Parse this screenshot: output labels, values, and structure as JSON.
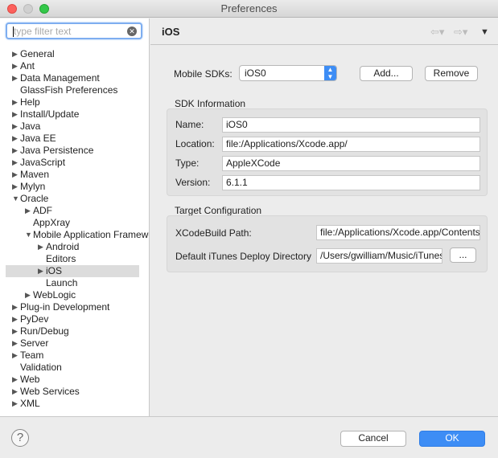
{
  "window": {
    "title": "Preferences"
  },
  "filter": {
    "placeholder": "type filter text"
  },
  "tree": [
    {
      "label": "General",
      "level": 0,
      "arrow": "right"
    },
    {
      "label": "Ant",
      "level": 0,
      "arrow": "right"
    },
    {
      "label": "Data Management",
      "level": 0,
      "arrow": "right"
    },
    {
      "label": "GlassFish Preferences",
      "level": 0,
      "arrow": ""
    },
    {
      "label": "Help",
      "level": 0,
      "arrow": "right"
    },
    {
      "label": "Install/Update",
      "level": 0,
      "arrow": "right"
    },
    {
      "label": "Java",
      "level": 0,
      "arrow": "right"
    },
    {
      "label": "Java EE",
      "level": 0,
      "arrow": "right"
    },
    {
      "label": "Java Persistence",
      "level": 0,
      "arrow": "right"
    },
    {
      "label": "JavaScript",
      "level": 0,
      "arrow": "right"
    },
    {
      "label": "Maven",
      "level": 0,
      "arrow": "right"
    },
    {
      "label": "Mylyn",
      "level": 0,
      "arrow": "right"
    },
    {
      "label": "Oracle",
      "level": 0,
      "arrow": "down"
    },
    {
      "label": "ADF",
      "level": 1,
      "arrow": "right"
    },
    {
      "label": "AppXray",
      "level": 1,
      "arrow": ""
    },
    {
      "label": "Mobile Application Framework",
      "level": 1,
      "arrow": "down"
    },
    {
      "label": "Android",
      "level": 2,
      "arrow": "right"
    },
    {
      "label": "Editors",
      "level": 2,
      "arrow": ""
    },
    {
      "label": "iOS",
      "level": 2,
      "arrow": "right",
      "selected": true
    },
    {
      "label": "Launch",
      "level": 2,
      "arrow": ""
    },
    {
      "label": "WebLogic",
      "level": 1,
      "arrow": "right"
    },
    {
      "label": "Plug-in Development",
      "level": 0,
      "arrow": "right"
    },
    {
      "label": "PyDev",
      "level": 0,
      "arrow": "right"
    },
    {
      "label": "Run/Debug",
      "level": 0,
      "arrow": "right"
    },
    {
      "label": "Server",
      "level": 0,
      "arrow": "right"
    },
    {
      "label": "Team",
      "level": 0,
      "arrow": "right"
    },
    {
      "label": "Validation",
      "level": 0,
      "arrow": ""
    },
    {
      "label": "Web",
      "level": 0,
      "arrow": "right"
    },
    {
      "label": "Web Services",
      "level": 0,
      "arrow": "right"
    },
    {
      "label": "XML",
      "level": 0,
      "arrow": "right"
    }
  ],
  "page": {
    "title": "iOS",
    "mobile_sdks_label": "Mobile SDKs:",
    "mobile_sdk_value": "iOS0",
    "add": "Add...",
    "remove": "Remove",
    "sdk_info": {
      "title": "SDK Information",
      "name_label": "Name:",
      "name": "iOS0",
      "location_label": "Location:",
      "location": "file:/Applications/Xcode.app/",
      "type_label": "Type:",
      "type": "AppleXCode",
      "version_label": "Version:",
      "version": "6.1.1"
    },
    "target": {
      "title": "Target Configuration",
      "xcodebuild_label": "XCodeBuild Path:",
      "xcodebuild": "file:/Applications/Xcode.app/Contents",
      "itunes_label": "Default iTunes Deploy Directory",
      "itunes": "/Users/gwilliam/Music/iTunes",
      "browse": "..."
    }
  },
  "footer": {
    "help": "?",
    "cancel": "Cancel",
    "ok": "OK"
  },
  "colors": {
    "accent": "#3d8df5"
  }
}
